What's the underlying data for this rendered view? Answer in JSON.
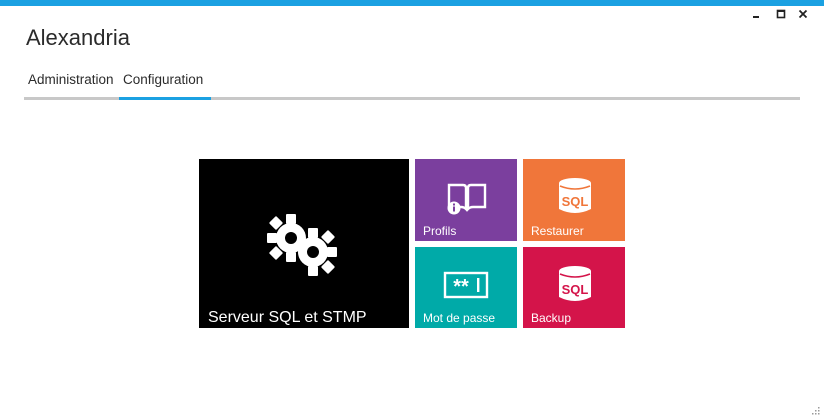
{
  "window": {
    "title": "Alexandria",
    "controls": [
      "minimize",
      "maximize",
      "close"
    ],
    "accent": "#1ba1e2"
  },
  "tabs": [
    {
      "label": "Administration",
      "active": false
    },
    {
      "label": "Configuration",
      "active": true
    }
  ],
  "tiles": {
    "server": {
      "label": "Serveur SQL et STMP",
      "color": "#000000",
      "icon": "gears-icon"
    },
    "profiles": {
      "label": "Profils",
      "color": "#7b3f9e",
      "icon": "book-info-icon"
    },
    "restore": {
      "label": "Restaurer",
      "color": "#f0763a",
      "icon": "sql-database-icon",
      "icon_text": "SQL"
    },
    "password": {
      "label": "Mot de passe",
      "color": "#00aaa8",
      "icon": "password-field-icon",
      "icon_text": "**"
    },
    "backup": {
      "label": "Backup",
      "color": "#d4144a",
      "icon": "sql-database-icon",
      "icon_text": "SQL"
    }
  }
}
